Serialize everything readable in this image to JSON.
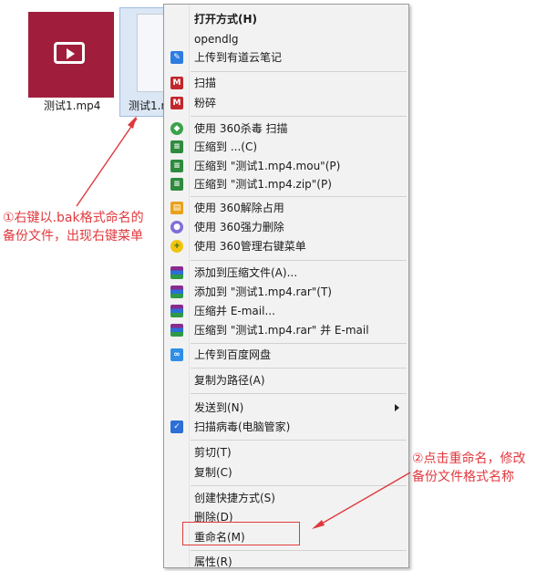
{
  "desktop": {
    "files": [
      {
        "name": "测试1.mp4",
        "icon": "video-file-icon"
      },
      {
        "name": "测试1.m",
        "icon": "document-file-icon"
      }
    ]
  },
  "context_menu": {
    "items": [
      {
        "label": "打开方式(H)",
        "icon": "",
        "bold": true
      },
      {
        "label": "opendlg",
        "icon": ""
      },
      {
        "label": "上传到有道云笔记",
        "icon": "youdao-note-icon"
      },
      {
        "label": "扫描",
        "icon": "mcafee-shield-icon"
      },
      {
        "label": "粉碎",
        "icon": "mcafee-shield-icon"
      },
      {
        "label": "使用 360杀毒 扫描",
        "icon": "360-antivirus-icon"
      },
      {
        "label": "压缩到 ...(C)",
        "icon": "compress-icon"
      },
      {
        "label": "压缩到 \"测试1.mp4.mou\"(P)",
        "icon": "compress-icon"
      },
      {
        "label": "压缩到 \"测试1.mp4.zip\"(P)",
        "icon": "compress-icon"
      },
      {
        "label": "使用 360解除占用",
        "icon": "folder-unlock-icon"
      },
      {
        "label": "使用 360强力删除",
        "icon": "force-delete-icon"
      },
      {
        "label": "使用 360管理右键菜单",
        "icon": "360-menu-manager-icon"
      },
      {
        "label": "添加到压缩文件(A)...",
        "icon": "winrar-icon"
      },
      {
        "label": "添加到 \"测试1.mp4.rar\"(T)",
        "icon": "winrar-icon"
      },
      {
        "label": "压缩并 E-mail...",
        "icon": "winrar-icon"
      },
      {
        "label": "压缩到 \"测试1.mp4.rar\" 并 E-mail",
        "icon": "winrar-icon"
      },
      {
        "label": "上传到百度网盘",
        "icon": "baidu-netdisk-icon"
      },
      {
        "label": "复制为路径(A)",
        "icon": ""
      },
      {
        "label": "发送到(N)",
        "icon": "",
        "submenu": true
      },
      {
        "label": "扫描病毒(电脑管家)",
        "icon": "pc-manager-shield-icon"
      },
      {
        "label": "剪切(T)",
        "icon": ""
      },
      {
        "label": "复制(C)",
        "icon": ""
      },
      {
        "label": "创建快捷方式(S)",
        "icon": ""
      },
      {
        "label": "删除(D)",
        "icon": ""
      },
      {
        "label": "重命名(M)",
        "icon": ""
      },
      {
        "label": "属性(R)",
        "icon": ""
      }
    ]
  },
  "annotations": {
    "note1_line1": "①右键以.bak格式命名的",
    "note1_line2": "备份文件，出现右键菜单",
    "note2_line1": "②点击重命名，修改",
    "note2_line2": "备份文件格式名称"
  },
  "colors": {
    "annotation": "#e0393e",
    "video_tile": "#a11d3c",
    "menu_bg": "#f2f2f2"
  }
}
